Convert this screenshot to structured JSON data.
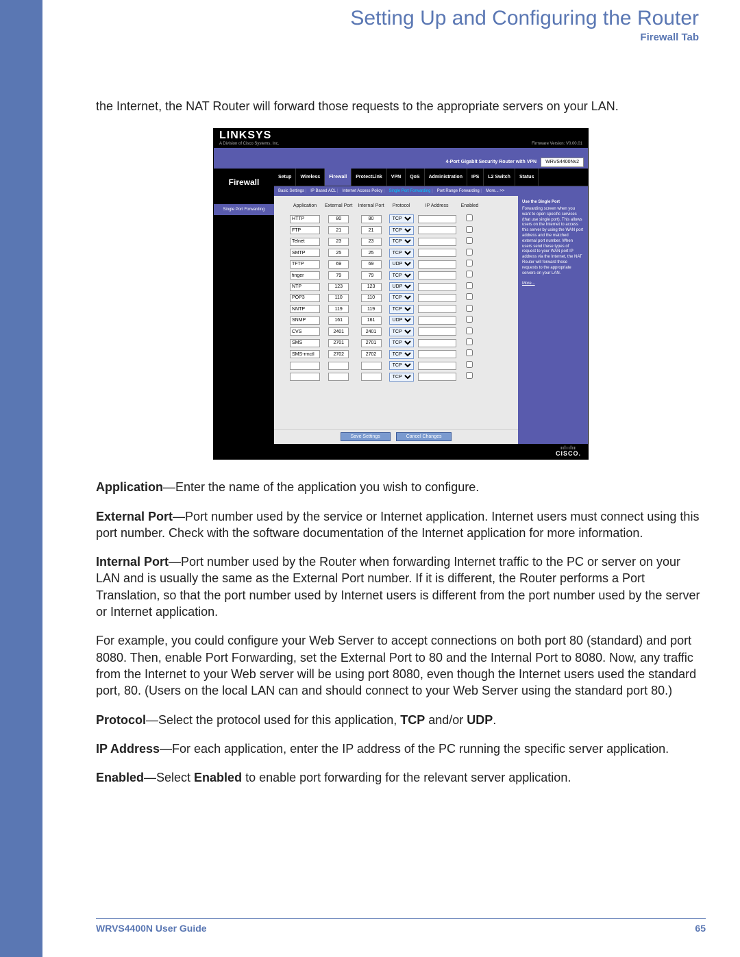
{
  "header": {
    "chapter": "Setting Up and Configuring the Router",
    "tab": "Firewall Tab"
  },
  "intro": "the Internet, the NAT Router will forward those requests to the appropriate servers on your LAN.",
  "screenshot": {
    "brand": "LINKSYS",
    "brand_sub": "A Division of Cisco Systems, Inc.",
    "firmware": "Firmware Version: V0.00.01",
    "product_desc": "4-Port Gigabit Security Router with VPN",
    "model": "WRVS4400Nv2",
    "section": "Firewall",
    "subsection": "Single Port Forwarding",
    "tabs": [
      "Setup",
      "Wireless",
      "Firewall",
      "ProtectLink",
      "VPN",
      "QoS",
      "Administration",
      "IPS",
      "L2 Switch",
      "Status"
    ],
    "active_tab": "Firewall",
    "subtabs": [
      "Basic Settings",
      "IP Based ACL",
      "Internet Access Policy",
      "Single Port Forwarding",
      "Port Range Forwarding",
      "More... >>"
    ],
    "active_subtab": "Single Port Forwarding",
    "cols": [
      "Application",
      "External Port",
      "Internal Port",
      "Protocol",
      "IP Address",
      "Enabled"
    ],
    "rows": [
      {
        "app": "HTTP",
        "ext": "80",
        "int": "80",
        "proto": "TCP"
      },
      {
        "app": "FTP",
        "ext": "21",
        "int": "21",
        "proto": "TCP"
      },
      {
        "app": "Telnet",
        "ext": "23",
        "int": "23",
        "proto": "TCP"
      },
      {
        "app": "SMTP",
        "ext": "25",
        "int": "25",
        "proto": "TCP"
      },
      {
        "app": "TFTP",
        "ext": "69",
        "int": "69",
        "proto": "UDP"
      },
      {
        "app": "finger",
        "ext": "79",
        "int": "79",
        "proto": "TCP"
      },
      {
        "app": "NTP",
        "ext": "123",
        "int": "123",
        "proto": "UDP"
      },
      {
        "app": "POP3",
        "ext": "110",
        "int": "110",
        "proto": "TCP"
      },
      {
        "app": "NNTP",
        "ext": "119",
        "int": "119",
        "proto": "TCP"
      },
      {
        "app": "SNMP",
        "ext": "161",
        "int": "161",
        "proto": "UDP"
      },
      {
        "app": "CVS",
        "ext": "2401",
        "int": "2401",
        "proto": "TCP"
      },
      {
        "app": "SMS",
        "ext": "2701",
        "int": "2701",
        "proto": "TCP"
      },
      {
        "app": "SMS-rmctl",
        "ext": "2702",
        "int": "2702",
        "proto": "TCP"
      },
      {
        "app": "",
        "ext": "",
        "int": "",
        "proto": "TCP"
      },
      {
        "app": "",
        "ext": "",
        "int": "",
        "proto": "TCP"
      }
    ],
    "help_title": "Use the Single Port",
    "help_body": "Forwarding screen when you want to open specific services (that use single port). This allows users on the Internet to access this server by using the WAN port address and the matched external port number. When users send these types of request to your WAN port IP address via the Internet, the NAT Router will forward those requests to the appropriate servers on your LAN.",
    "help_more": "More...",
    "save_btn": "Save Settings",
    "cancel_btn": "Cancel Changes",
    "cisco": "CISCO."
  },
  "fields": {
    "application": {
      "label": "Application",
      "desc": "—Enter the name of the application you wish to configure."
    },
    "external": {
      "label": "External Port",
      "desc": "—Port number used by the service or Internet application. Internet users must connect using this port number. Check with the software documentation of the Internet application for more information."
    },
    "internal": {
      "label": "Internal Port",
      "desc": "—Port number used by the Router when forwarding Internet traffic to the PC or server on your LAN and is usually the same as the External Port number. If it is different, the Router performs a Port Translation, so that the port number used by Internet users is different from the port number used by the server or Internet application."
    },
    "example": "For example, you could configure your Web Server to accept connections on both port 80 (standard) and port 8080. Then, enable Port Forwarding, set the External Port to 80 and the Internal Port to 8080. Now, any traffic from the Internet to your Web server will be using port 8080, even though the Internet users used the standard port, 80. (Users on the local LAN can and should connect to your Web Server using the standard port 80.)",
    "protocol": {
      "label": "Protocol",
      "desc": "—Select the protocol used for this application, ",
      "b1": "TCP",
      "mid": " and/or ",
      "b2": "UDP",
      "tail": "."
    },
    "ip": {
      "label": "IP Address",
      "desc": "—For each application, enter the IP address of the PC running the specific server application."
    },
    "enabled": {
      "label": "Enabled",
      "pre": "—Select ",
      "b": "Enabled",
      "desc": " to enable port forwarding for the relevant server application."
    }
  },
  "footer": {
    "guide": "WRVS4400N User Guide",
    "page": "65"
  }
}
